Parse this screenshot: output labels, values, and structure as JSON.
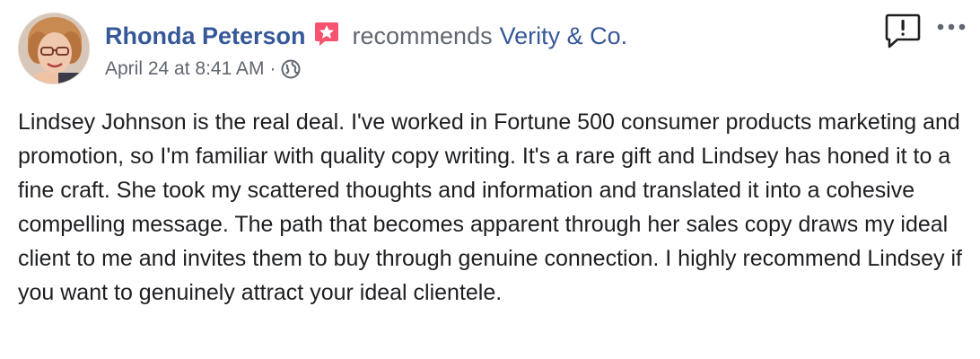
{
  "post": {
    "author": "Rhonda Peterson",
    "action_text": "recommends",
    "page_name": "Verity & Co.",
    "timestamp": "April 24 at 8:41 AM",
    "separator": "·",
    "privacy_icon": "globe-icon",
    "badge_icon": "star-badge-icon",
    "badge_color": "#f5536f",
    "link_color": "#365899",
    "meta_color": "#606770",
    "body": "Lindsey Johnson is the real deal. I've worked in Fortune 500 consumer products marketing and promotion, so I'm familiar with quality copy writing. It's a rare gift and Lindsey has honed it to a fine craft. She took my scattered thoughts and information and translated it into a cohesive compelling message. The path that becomes apparent through her sales copy draws my ideal client to me and invites them to buy through genuine connection. I highly recommend Lindsey if you want to genuinely attract your ideal clientele."
  },
  "actions": {
    "report_icon": "report-icon",
    "more_icon": "more-options-icon"
  }
}
